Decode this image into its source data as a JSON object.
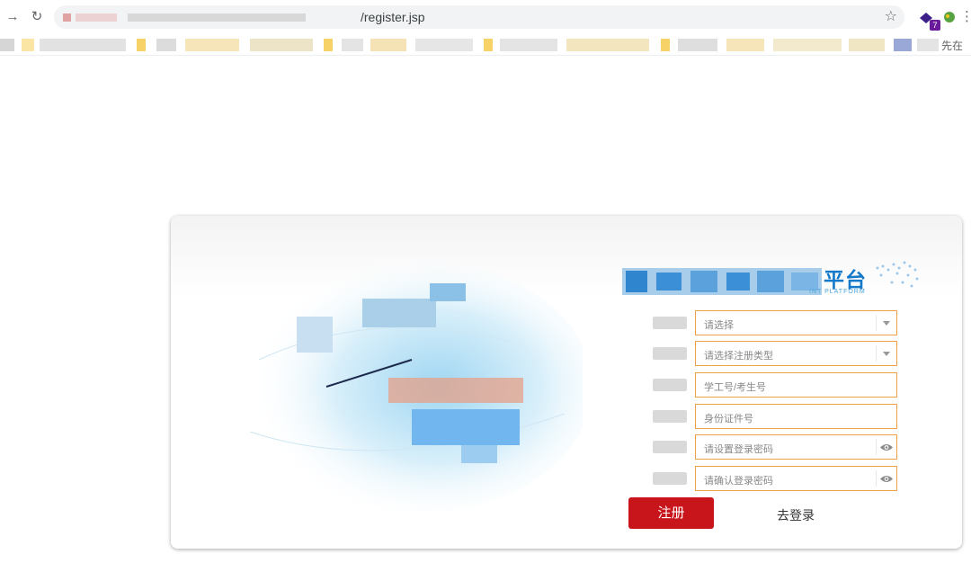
{
  "browser": {
    "url_visible": "/register.jsp",
    "extension_badge": "7",
    "bookmark_tail": "先在"
  },
  "brand": {
    "title_visible": "平台",
    "subtitle_visible": "INT PLATFORM",
    "accent_color": "#1579c9"
  },
  "form": {
    "fields": [
      {
        "placeholder": "请选择",
        "kind": "select"
      },
      {
        "placeholder": "请选择注册类型",
        "kind": "select"
      },
      {
        "placeholder": "学工号/考生号",
        "kind": "text"
      },
      {
        "placeholder": "身份证件号",
        "kind": "text"
      },
      {
        "placeholder": "请设置登录密码",
        "kind": "password"
      },
      {
        "placeholder": "请确认登录密码",
        "kind": "password"
      }
    ],
    "submit_label": "注册",
    "login_label": "去登录",
    "field_border_color": "#f0a04a",
    "submit_color": "#c8141b"
  },
  "icons": {
    "back": "arrow-right-icon",
    "reload": "reload-icon",
    "bookmark": "star-icon",
    "select": "chevron-down-icon",
    "password": "eye-icon"
  }
}
